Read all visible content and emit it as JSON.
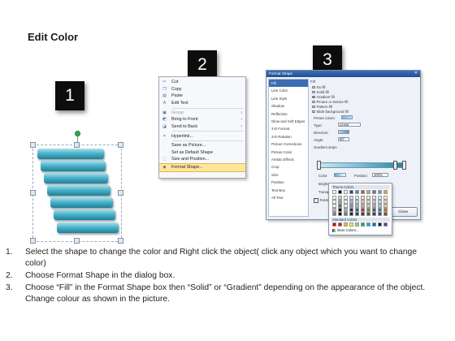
{
  "page": {
    "title": "Edit Color"
  },
  "callouts": [
    "1",
    "2",
    "3"
  ],
  "context_menu": {
    "items": [
      {
        "label": "Cut",
        "icon": "scissors-icon",
        "disabled": false
      },
      {
        "label": "Copy",
        "icon": "copy-icon",
        "disabled": false
      },
      {
        "label": "Paste",
        "icon": "paste-icon",
        "disabled": false
      },
      {
        "label": "Edit Text",
        "icon": "edit-text-icon",
        "disabled": false
      },
      {
        "label": "Group",
        "icon": "group-icon",
        "disabled": true,
        "submenu": true
      },
      {
        "label": "Bring to Front",
        "icon": "bring-front-icon",
        "disabled": false,
        "submenu": true
      },
      {
        "label": "Send to Back",
        "icon": "send-back-icon",
        "disabled": false,
        "submenu": true
      },
      {
        "label": "Hyperlink...",
        "icon": "hyperlink-icon",
        "disabled": false
      },
      {
        "label": "Save as Picture...",
        "icon": "",
        "disabled": false
      },
      {
        "label": "Set as Default Shape",
        "icon": "",
        "disabled": false
      },
      {
        "label": "Size and Position...",
        "icon": "size-icon",
        "disabled": false
      },
      {
        "label": "Format Shape...",
        "icon": "format-icon",
        "disabled": false,
        "highlighted": true
      }
    ]
  },
  "dialog": {
    "title": "Format Shape",
    "categories": [
      "Fill",
      "Line Color",
      "Line Style",
      "Shadow",
      "Reflection",
      "Glow and Soft Edges",
      "3-D Format",
      "3-D Rotation",
      "Picture Corrections",
      "Picture Color",
      "Artistic Effects",
      "Crop",
      "Size",
      "Position",
      "Text Box",
      "Alt Text"
    ],
    "pane_title": "Fill",
    "fill_options": [
      "No fill",
      "Solid fill",
      "Gradient fill",
      "Picture or texture fill",
      "Pattern fill",
      "Slide background fill"
    ],
    "selected_fill": "Gradient fill",
    "fields": {
      "preset_colors": "Preset colors:",
      "type": "Type:",
      "type_value": "Linear",
      "direction": "Direction:",
      "angle": "Angle:",
      "angle_value": "90°",
      "gradient_stops": "Gradient stops",
      "color": "Color",
      "position": "Position:",
      "position_value": "100%",
      "brightness": "Brightness",
      "transparency": "Transparency",
      "rotate_with_shape": "Rotate with shape"
    },
    "close_label": "Close"
  },
  "palette": {
    "theme_label": "Theme Colors",
    "standard_label": "Standard Colors",
    "more_label": "More Colors...",
    "theme_top": [
      "#ffffff",
      "#000000",
      "#eeece1",
      "#1f497d",
      "#4f81bd",
      "#c0504d",
      "#9bbb59",
      "#8064a2",
      "#4bacc6",
      "#f79646"
    ],
    "standard": [
      "#c00000",
      "#ff0000",
      "#ffc000",
      "#ffff00",
      "#92d050",
      "#00b050",
      "#00b0f0",
      "#0070c0",
      "#002060",
      "#7030a0"
    ]
  },
  "instructions": [
    {
      "n": "1.",
      "text": "Select the shape to change the color and Right click the object( click any object which you want to change color)"
    },
    {
      "n": "2.",
      "text": "Choose Format Shape in the dialog box."
    },
    {
      "n": "3.",
      "text": "Choose “Fill” in the Format Shape box then “Solid” or “Gradient” depending on the appearance of the object. Change colour as shown in the picture."
    }
  ]
}
